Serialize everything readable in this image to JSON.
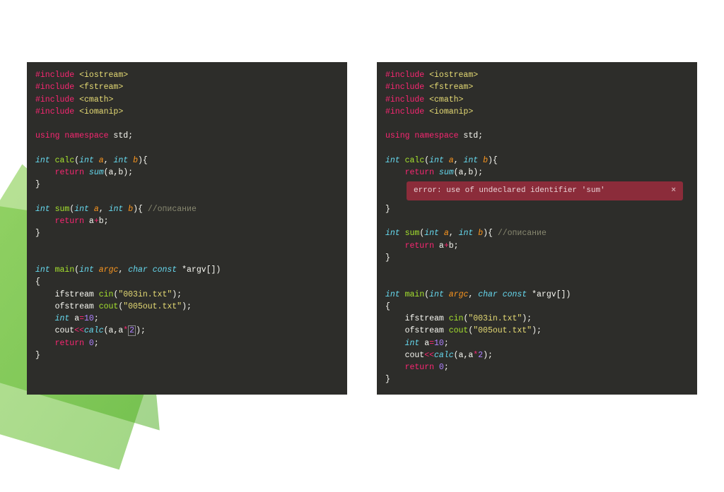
{
  "left": {
    "inc1_a": "#include",
    "inc1_b": " <iostream>",
    "inc2_a": "#include",
    "inc2_b": " <fstream>",
    "inc3_a": "#include",
    "inc3_b": " <cmath>",
    "inc4_a": "#include",
    "inc4_b": " <iomanip>",
    "using_a": "using",
    "using_b": " namespace",
    "using_c": " std;",
    "calc_int1": "int",
    "calc_name": " calc",
    "calc_p1": "(",
    "calc_int2": "int",
    "calc_a": " a",
    "calc_c1": ", ",
    "calc_int3": "int",
    "calc_b": " b",
    "calc_p2": "){",
    "calc_ret": "    return",
    "calc_sum": " sum",
    "calc_args": "(a,b);",
    "calc_close": "}",
    "sum_int1": "int",
    "sum_name": " sum",
    "sum_p1": "(",
    "sum_int2": "int",
    "sum_a": " a",
    "sum_c1": ", ",
    "sum_int3": "int",
    "sum_b": " b",
    "sum_p2": "){ ",
    "sum_comment": "//описание",
    "sum_ret": "    return",
    "sum_expr_a": " a",
    "sum_expr_op": "+",
    "sum_expr_b": "b;",
    "sum_close": "}",
    "main_int": "int",
    "main_name": " main",
    "main_p1": "(",
    "main_int2": "int",
    "main_argc": " argc",
    "main_c": ", ",
    "main_char": "char",
    "main_const": " const",
    "main_argv": " *argv[])",
    "main_open": "{",
    "main_if": "    ifstream ",
    "main_cin": "cin",
    "main_if_p": "(",
    "main_if_str": "\"003in.txt\"",
    "main_if_e": ");",
    "main_of": "    ofstream ",
    "main_cout": "cout",
    "main_of_p": "(",
    "main_of_str": "\"005out.txt\"",
    "main_of_e": ");",
    "main_int_a": "    int",
    "main_a": " a",
    "main_eq": "=",
    "main_ten": "10",
    "main_semi": ";",
    "main_coutl": "    cout",
    "main_ls": "<<",
    "main_calc": "calc",
    "main_ca": "(a,a",
    "main_star": "*",
    "main_two": "2",
    "main_ce": ");",
    "main_ret": "    return",
    "main_zero": " 0",
    "main_rs": ";",
    "main_close": "}"
  },
  "right": {
    "error_text": "error: use of undeclared identifier 'sum'",
    "error_close": "×"
  }
}
